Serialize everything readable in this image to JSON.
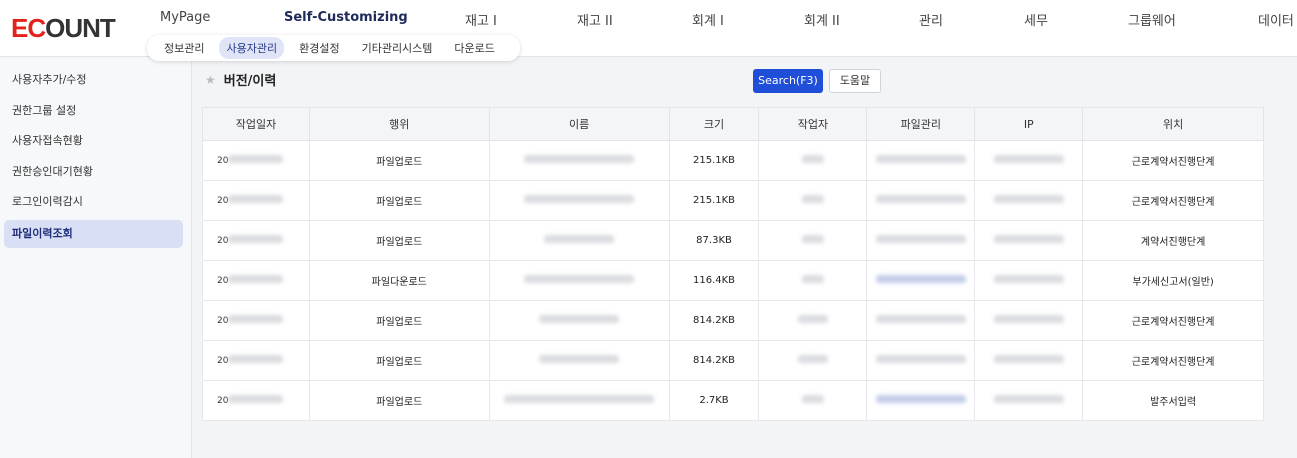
{
  "logo": {
    "text_red": "EC",
    "text_dark": "OUNT"
  },
  "mainnav": {
    "items": [
      "MyPage",
      "Self-Customizing",
      "재고 I",
      "재고 II",
      "회계 I",
      "회계 II",
      "관리",
      "세무",
      "그룹웨어",
      "데이터"
    ]
  },
  "subnav": {
    "items": [
      "정보관리",
      "사용자관리",
      "환경설정",
      "기타관리시스템",
      "다운로드"
    ]
  },
  "sidebar": {
    "items": [
      "사용자추가/수정",
      "권한그룹 설정",
      "사용자접속현황",
      "권한승인대기현황",
      "로그인이력감시",
      "파일이력조회"
    ]
  },
  "page": {
    "title": "버전/이력",
    "search_label": "Search(F3)",
    "help_label": "도움말"
  },
  "table": {
    "headers": [
      "작업일자",
      "행위",
      "이름",
      "크기",
      "작업자",
      "파일관리",
      "IP",
      "위치"
    ],
    "rows": [
      {
        "date_prefix": "20",
        "action": "파일업로드",
        "size": "215.1KB",
        "location": "근로계약서진행단계"
      },
      {
        "date_prefix": "20",
        "action": "파일업로드",
        "size": "215.1KB",
        "location": "근로계약서진행단계"
      },
      {
        "date_prefix": "20",
        "action": "파일업로드",
        "size": "87.3KB",
        "location": "계약서진행단계"
      },
      {
        "date_prefix": "20",
        "action": "파일다운로드",
        "size": "116.4KB",
        "location": "부가세신고서(일반)"
      },
      {
        "date_prefix": "20",
        "action": "파일업로드",
        "size": "814.2KB",
        "location": "근로계약서진행단계"
      },
      {
        "date_prefix": "20",
        "action": "파일업로드",
        "size": "814.2KB",
        "location": "근로계약서진행단계"
      },
      {
        "date_prefix": "20",
        "action": "파일업로드",
        "size": "2.7KB",
        "location": "발주서입력"
      }
    ]
  },
  "colors": {
    "accent": "#1f4ed8",
    "logo_red": "#e2231a",
    "active_bg": "#d9dff5",
    "table_top_border": "#2f8a5c"
  }
}
